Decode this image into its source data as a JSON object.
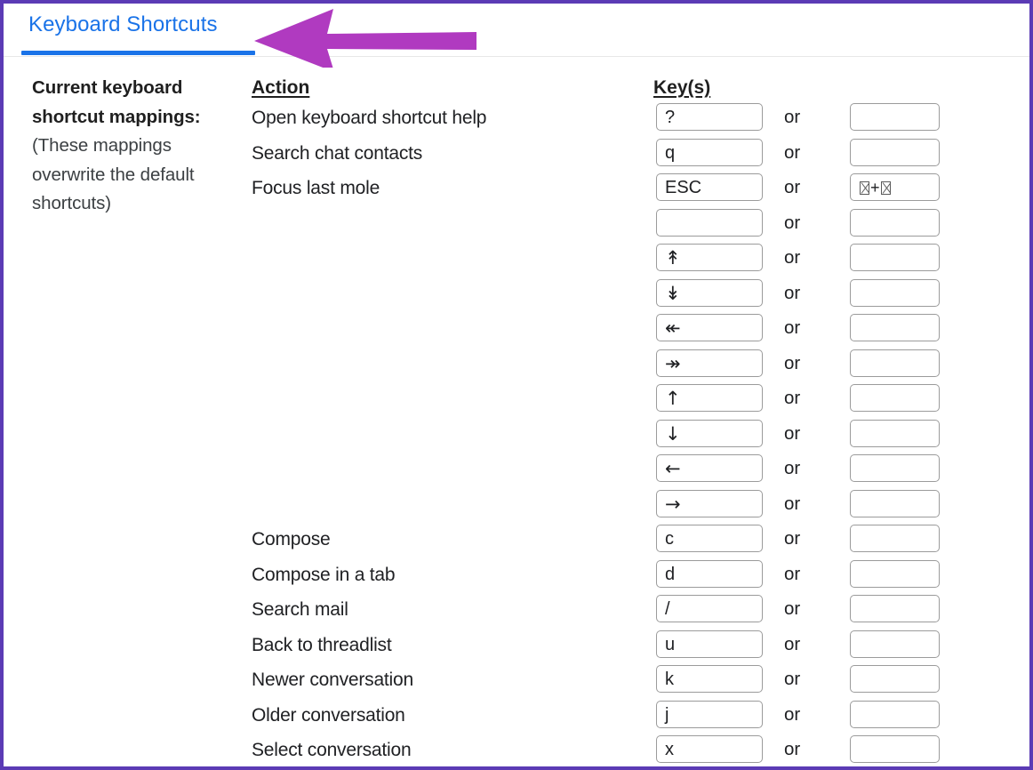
{
  "window": {
    "border_color": "#5b3bb5",
    "background": "#ffffff"
  },
  "tab": {
    "label": "Keyboard Shortcuts",
    "active": true,
    "accent_color": "#1a73e8"
  },
  "annotation": {
    "type": "arrow-left",
    "color": "#b03ac0",
    "points_to": "Keyboard Shortcuts"
  },
  "intro": {
    "heading_line_1": "Current keyboard",
    "heading_line_2": "shortcut mappings:",
    "note_line_1": "(These mappings",
    "note_line_2": "overwrite the default",
    "note_line_3": "shortcuts)"
  },
  "columns": {
    "action_header": "Action",
    "keys_header": "Key(s)",
    "or_label": "or"
  },
  "rows": [
    {
      "action": "Open keyboard shortcut help",
      "key_primary": "?",
      "key_secondary": ""
    },
    {
      "action": "Search chat contacts",
      "key_primary": "q",
      "key_secondary": ""
    },
    {
      "action": "Focus last mole",
      "key_primary": "ESC",
      "key_secondary": "□+□",
      "secondary_is_tofu_combo": true
    },
    {
      "action": "",
      "key_primary": "",
      "key_secondary": ""
    },
    {
      "action": "",
      "key_primary": "↟",
      "key_secondary": ""
    },
    {
      "action": "",
      "key_primary": "↡",
      "key_secondary": ""
    },
    {
      "action": "",
      "key_primary": "↞",
      "key_secondary": ""
    },
    {
      "action": "",
      "key_primary": "↠",
      "key_secondary": ""
    },
    {
      "action": "",
      "key_primary": "↑",
      "key_secondary": ""
    },
    {
      "action": "",
      "key_primary": "↓",
      "key_secondary": ""
    },
    {
      "action": "",
      "key_primary": "←",
      "key_secondary": ""
    },
    {
      "action": "",
      "key_primary": "→",
      "key_secondary": ""
    },
    {
      "action": "Compose",
      "key_primary": "c",
      "key_secondary": ""
    },
    {
      "action": "Compose in a tab",
      "key_primary": "d",
      "key_secondary": ""
    },
    {
      "action": "Search mail",
      "key_primary": "/",
      "key_secondary": ""
    },
    {
      "action": "Back to threadlist",
      "key_primary": "u",
      "key_secondary": ""
    },
    {
      "action": "Newer conversation",
      "key_primary": "k",
      "key_secondary": ""
    },
    {
      "action": "Older conversation",
      "key_primary": "j",
      "key_secondary": ""
    },
    {
      "action": "Select conversation",
      "key_primary": "x",
      "key_secondary": ""
    }
  ]
}
